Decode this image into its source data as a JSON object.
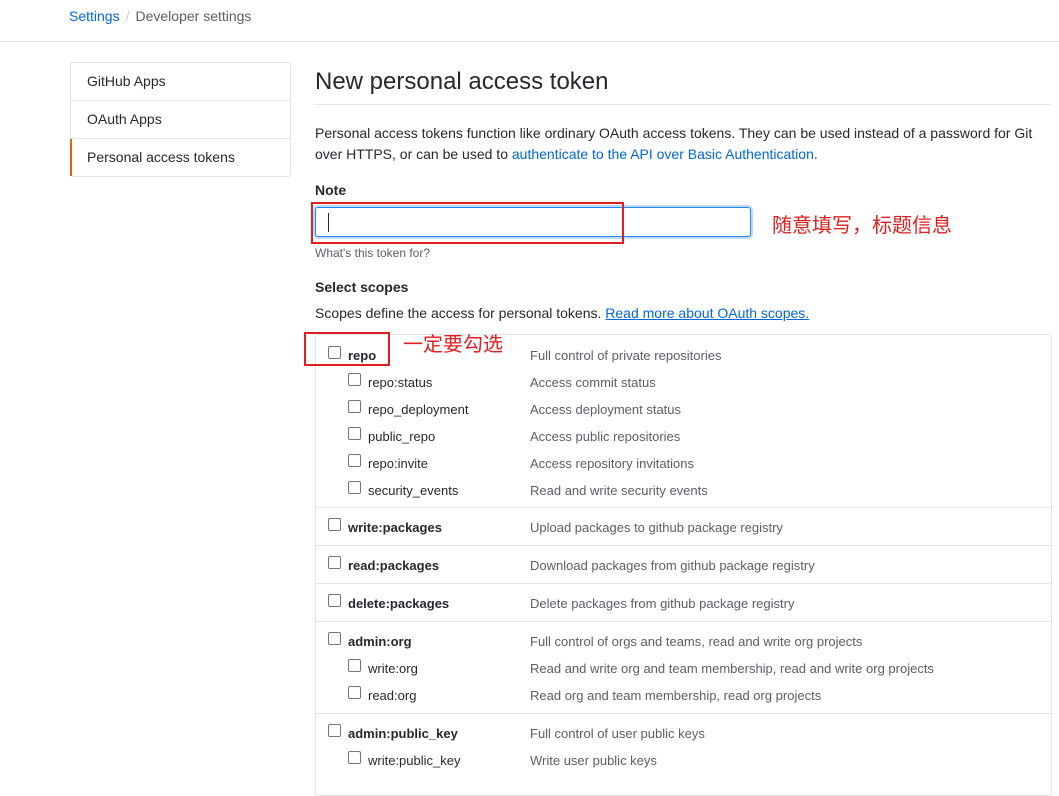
{
  "breadcrumb": {
    "root": "Settings",
    "separator": "/",
    "current": "Developer settings"
  },
  "sidebar": {
    "items": [
      {
        "label": "GitHub Apps",
        "selected": false
      },
      {
        "label": "OAuth Apps",
        "selected": false
      },
      {
        "label": "Personal access tokens",
        "selected": true
      }
    ]
  },
  "main": {
    "title": "New personal access token",
    "intro_text": "Personal access tokens function like ordinary OAuth access tokens. They can be used instead of a password for Git over HTTPS, or can be used to ",
    "intro_link": "authenticate to the API over Basic Authentication",
    "intro_end": ".",
    "note_label": "Note",
    "note_value": "",
    "note_hint": "What's this token for?",
    "scopes_title": "Select scopes",
    "scopes_desc": "Scopes define the access for personal tokens. ",
    "scopes_link": "Read more about OAuth scopes."
  },
  "scopes": [
    {
      "name": "repo",
      "desc": "Full control of private repositories",
      "checked": false,
      "children": [
        {
          "name": "repo:status",
          "desc": "Access commit status",
          "checked": false
        },
        {
          "name": "repo_deployment",
          "desc": "Access deployment status",
          "checked": false
        },
        {
          "name": "public_repo",
          "desc": "Access public repositories",
          "checked": false
        },
        {
          "name": "repo:invite",
          "desc": "Access repository invitations",
          "checked": false
        },
        {
          "name": "security_events",
          "desc": "Read and write security events",
          "checked": false
        }
      ]
    },
    {
      "name": "write:packages",
      "desc": "Upload packages to github package registry",
      "checked": false,
      "children": []
    },
    {
      "name": "read:packages",
      "desc": "Download packages from github package registry",
      "checked": false,
      "children": []
    },
    {
      "name": "delete:packages",
      "desc": "Delete packages from github package registry",
      "checked": false,
      "children": []
    },
    {
      "name": "admin:org",
      "desc": "Full control of orgs and teams, read and write org projects",
      "checked": false,
      "children": [
        {
          "name": "write:org",
          "desc": "Read and write org and team membership, read and write org projects",
          "checked": false
        },
        {
          "name": "read:org",
          "desc": "Read org and team membership, read org projects",
          "checked": false
        }
      ]
    },
    {
      "name": "admin:public_key",
      "desc": "Full control of user public keys",
      "checked": false,
      "children": [
        {
          "name": "write:public_key",
          "desc": "Write user public keys",
          "checked": false
        }
      ]
    }
  ],
  "annotations": {
    "note_tip": "随意填写，标题信息",
    "repo_tip": "一定要勾选",
    "color": "#e02020"
  },
  "colors": {
    "link": "#0366d6",
    "selected_indicator": "#e36209",
    "focus_border": "#2188ff"
  }
}
